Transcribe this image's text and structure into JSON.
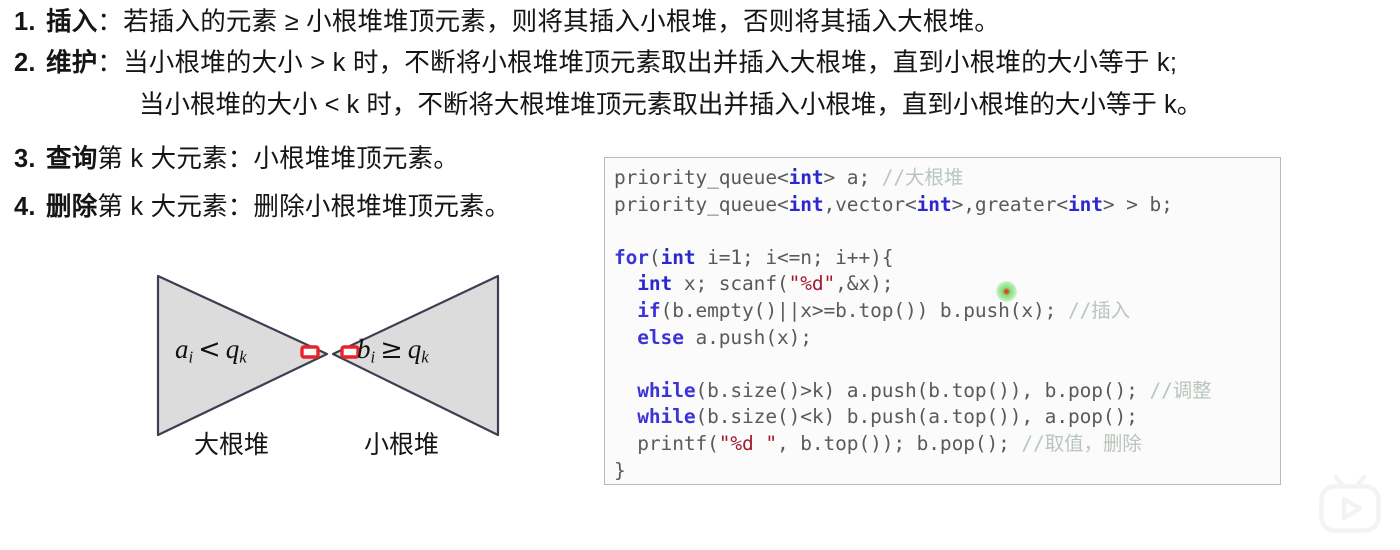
{
  "steps": [
    {
      "num": "1.",
      "keyword": "插入",
      "text": "：若插入的元素 ≥ 小根堆堆顶元素，则将其插入小根堆，否则将其插入大根堆。",
      "sub": null
    },
    {
      "num": "2.",
      "keyword": "维护",
      "text": "：当小根堆的大小 > k 时，不断将小根堆堆顶元素取出并插入大根堆，直到小根堆的大小等于 k;",
      "sub": "当小根堆的大小 < k 时，不断将大根堆堆顶元素取出并插入小根堆，直到小根堆的大小等于 k。"
    },
    {
      "num": "3.",
      "keyword": "查询",
      "text": "第 k 大元素：小根堆堆顶元素。",
      "sub": null
    },
    {
      "num": "4.",
      "keyword": "删除",
      "text": "第 k 大元素：删除小根堆堆顶元素。",
      "sub": null
    }
  ],
  "diagram": {
    "left_label": "大根堆",
    "right_label": "小根堆",
    "left_formula": {
      "var": "a",
      "sub": "i",
      "op": "<",
      "var2": "q",
      "sub2": "k"
    },
    "right_formula": {
      "var": "b",
      "sub": "i",
      "op": "≥",
      "var2": "q",
      "sub2": "k"
    },
    "fill_color": "#dcdcdc",
    "stroke_color": "#3a3f52",
    "marker_color": "#e8232a"
  },
  "code": {
    "lines": [
      [
        {
          "t": "priority_queue",
          "c": "plain"
        },
        {
          "t": "<",
          "c": "plain"
        },
        {
          "t": "int",
          "c": "type"
        },
        {
          "t": "> a; ",
          "c": "plain"
        },
        {
          "t": "//大根堆",
          "c": "comment"
        }
      ],
      [
        {
          "t": "priority_queue",
          "c": "plain"
        },
        {
          "t": "<",
          "c": "plain"
        },
        {
          "t": "int",
          "c": "type"
        },
        {
          "t": ",vector<",
          "c": "plain"
        },
        {
          "t": "int",
          "c": "type"
        },
        {
          "t": ">,greater<",
          "c": "plain"
        },
        {
          "t": "int",
          "c": "type"
        },
        {
          "t": "> > b;",
          "c": "plain"
        }
      ],
      [],
      [
        {
          "t": "for",
          "c": "keyword"
        },
        {
          "t": "(",
          "c": "plain"
        },
        {
          "t": "int",
          "c": "type"
        },
        {
          "t": " i=1; i<=n; i++){",
          "c": "plain"
        }
      ],
      [
        {
          "t": "  ",
          "c": "plain"
        },
        {
          "t": "int",
          "c": "type"
        },
        {
          "t": " x; scanf(",
          "c": "plain"
        },
        {
          "t": "\"%d\"",
          "c": "string"
        },
        {
          "t": ",&x);",
          "c": "plain"
        }
      ],
      [
        {
          "t": "  ",
          "c": "plain"
        },
        {
          "t": "if",
          "c": "keyword"
        },
        {
          "t": "(b.empty()||x>=b.top()) b.push(x); ",
          "c": "plain"
        },
        {
          "t": "//插入",
          "c": "comment"
        }
      ],
      [
        {
          "t": "  ",
          "c": "plain"
        },
        {
          "t": "else",
          "c": "keyword"
        },
        {
          "t": " a.push(x);",
          "c": "plain"
        }
      ],
      [],
      [
        {
          "t": "  ",
          "c": "plain"
        },
        {
          "t": "while",
          "c": "keyword"
        },
        {
          "t": "(b.size()>k) a.push(b.top()), b.pop(); ",
          "c": "plain"
        },
        {
          "t": "//调整",
          "c": "comment"
        }
      ],
      [
        {
          "t": "  ",
          "c": "plain"
        },
        {
          "t": "while",
          "c": "keyword"
        },
        {
          "t": "(b.size()<k) b.push(a.top()), a.pop();",
          "c": "plain"
        }
      ],
      [
        {
          "t": "  printf(",
          "c": "plain"
        },
        {
          "t": "\"%d \"",
          "c": "string"
        },
        {
          "t": ", b.top()); b.pop(); ",
          "c": "plain"
        },
        {
          "t": "//取值，删除",
          "c": "comment"
        }
      ],
      [
        {
          "t": "}",
          "c": "plain"
        }
      ]
    ]
  },
  "watermark": {
    "icon": "tv-play-logo-icon",
    "color": "#f4f4f4"
  }
}
